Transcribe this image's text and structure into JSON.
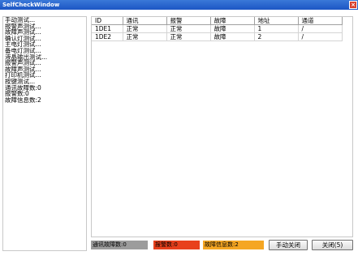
{
  "window": {
    "title": "SelfCheckWindow",
    "close_glyph": "×"
  },
  "left_list": [
    "手动测试...",
    "报警声测试...",
    "故障声测试...",
    "确认灯测试...",
    "主电灯测试...",
    "备电灯测试...",
    "液晶输出测试...",
    "报警声测试...",
    "故障声测试...",
    "打印机测试...",
    "按键测试...",
    "通讯故障数:0",
    "报警数:0",
    "故障信息数:2"
  ],
  "table": {
    "columns": [
      "ID",
      "通讯",
      "报警",
      "故障",
      "地址",
      "通道"
    ],
    "rows": [
      [
        "1DE1",
        "正常",
        "正常",
        "故障",
        "1",
        "/"
      ],
      [
        "1DE2",
        "正常",
        "正常",
        "故障",
        "2",
        "/"
      ]
    ]
  },
  "status": {
    "comm_fault": "通讯故障数:0",
    "alarm": "报警数:0",
    "fault_info": "故障信息数:2"
  },
  "buttons": {
    "manual_close": "手动关闭",
    "close": "关闭(5)"
  },
  "colors": {
    "titlebar": "#2a66d0",
    "status_grey": "#9c9c9c",
    "status_red": "#e8401c",
    "status_orange": "#f5a623"
  }
}
